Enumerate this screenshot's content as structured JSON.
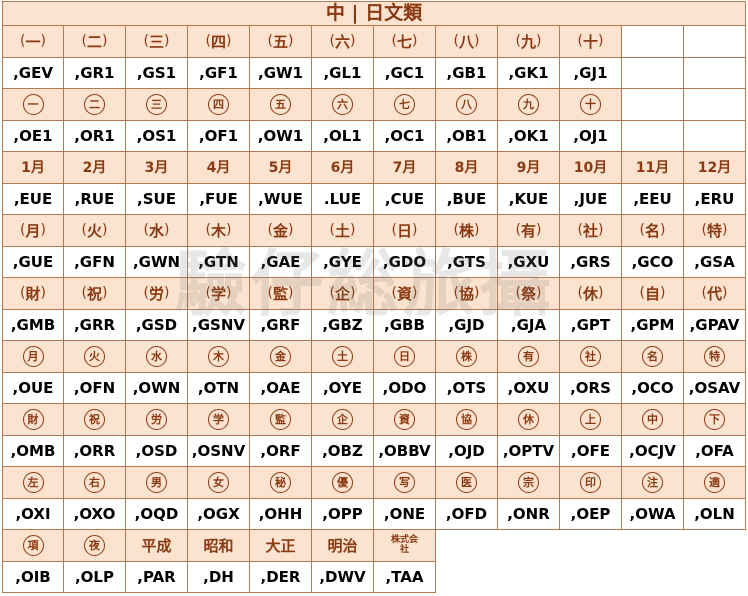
{
  "title": "中 | 日文類",
  "watermark": "驗仔総旅攝",
  "rows": [
    {
      "type": "glyph",
      "style": "paren",
      "cells": [
        "一",
        "二",
        "三",
        "四",
        "五",
        "六",
        "七",
        "八",
        "九",
        "十",
        "",
        ""
      ]
    },
    {
      "type": "code",
      "cells": [
        ",GEV",
        ",GR1",
        ",GS1",
        ",GF1",
        ",GW1",
        ",GL1",
        ",GC1",
        ",GB1",
        ",GK1",
        ",GJ1",
        "",
        ""
      ]
    },
    {
      "type": "glyph",
      "style": "circle",
      "cells": [
        "一",
        "二",
        "三",
        "四",
        "五",
        "六",
        "七",
        "八",
        "九",
        "十",
        "",
        ""
      ]
    },
    {
      "type": "code",
      "cells": [
        ",OE1",
        ",OR1",
        ",OS1",
        ",OF1",
        ",OW1",
        ",OL1",
        ",OC1",
        ",OB1",
        ",OK1",
        ",OJ1",
        "",
        ""
      ]
    },
    {
      "type": "glyph",
      "style": "month",
      "cells": [
        "1月",
        "2月",
        "3月",
        "4月",
        "5月",
        "6月",
        "7月",
        "8月",
        "9月",
        "10月",
        "11月",
        "12月"
      ]
    },
    {
      "type": "code",
      "cells": [
        ",EUE",
        ",RUE",
        ",SUE",
        ",FUE",
        ",WUE",
        ".LUE",
        ",CUE",
        ",BUE",
        ",KUE",
        ",JUE",
        ",EEU",
        ",ERU"
      ]
    },
    {
      "type": "glyph",
      "style": "paren",
      "cells": [
        "月",
        "火",
        "水",
        "木",
        "金",
        "土",
        "日",
        "株",
        "有",
        "社",
        "名",
        "特"
      ]
    },
    {
      "type": "code",
      "cells": [
        ",GUE",
        ",GFN",
        ",GWN",
        ",GTN",
        ",GAE",
        ",GYE",
        ",GDO",
        ",GTS",
        ",GXU",
        ",GRS",
        ",GCO",
        ",GSA"
      ]
    },
    {
      "type": "glyph",
      "style": "paren",
      "cells": [
        "財",
        "祝",
        "労",
        "学",
        "監",
        "企",
        "資",
        "協",
        "祭",
        "休",
        "自",
        "代"
      ]
    },
    {
      "type": "code",
      "cells": [
        ",GMB",
        ",GRR",
        ",GSD",
        ",GSNV",
        ",GRF",
        ",GBZ",
        ",GBB",
        ",GJD",
        ",GJA",
        ",GPT",
        ",GPM",
        ",GPAV"
      ]
    },
    {
      "type": "glyph",
      "style": "circle",
      "cells": [
        "月",
        "火",
        "水",
        "木",
        "金",
        "土",
        "日",
        "株",
        "有",
        "社",
        "名",
        "特"
      ]
    },
    {
      "type": "code",
      "cells": [
        ",OUE",
        ",OFN",
        ",OWN",
        ",OTN",
        ",OAE",
        ",OYE",
        ",ODO",
        ",OTS",
        ",OXU",
        ",ORS",
        ",OCO",
        ",OSAV"
      ]
    },
    {
      "type": "glyph",
      "style": "circle",
      "cells": [
        "財",
        "祝",
        "労",
        "学",
        "監",
        "企",
        "資",
        "協",
        "休",
        "上",
        "中",
        "下"
      ]
    },
    {
      "type": "code",
      "cells": [
        ",OMB",
        ",ORR",
        ",OSD",
        ",OSNV",
        ",ORF",
        ",OBZ",
        ",OBBV",
        ",OJD",
        ",OPTV",
        ",OFE",
        ",OCJV",
        ",OFA"
      ]
    },
    {
      "type": "glyph",
      "style": "circle",
      "cells": [
        "左",
        "右",
        "男",
        "女",
        "秘",
        "優",
        "写",
        "医",
        "宗",
        "印",
        "注",
        "適"
      ]
    },
    {
      "type": "code",
      "cells": [
        ",OXI",
        ",OXO",
        ",OQD",
        ",OGX",
        ",OHH",
        ",OPP",
        ",ONE",
        ",OFD",
        ",ONR",
        ",OEP",
        ",OWA",
        ",OLN"
      ]
    },
    {
      "type": "glyph",
      "style": "mixed",
      "cells": [
        "項",
        "夜",
        "平成",
        "昭和",
        "大正",
        "明治",
        "株式会社"
      ]
    },
    {
      "type": "code",
      "cells": [
        ",OIB",
        ",OLP",
        ",PAR",
        ",DH",
        ",DER",
        ",DWV",
        ",TAA"
      ]
    }
  ]
}
